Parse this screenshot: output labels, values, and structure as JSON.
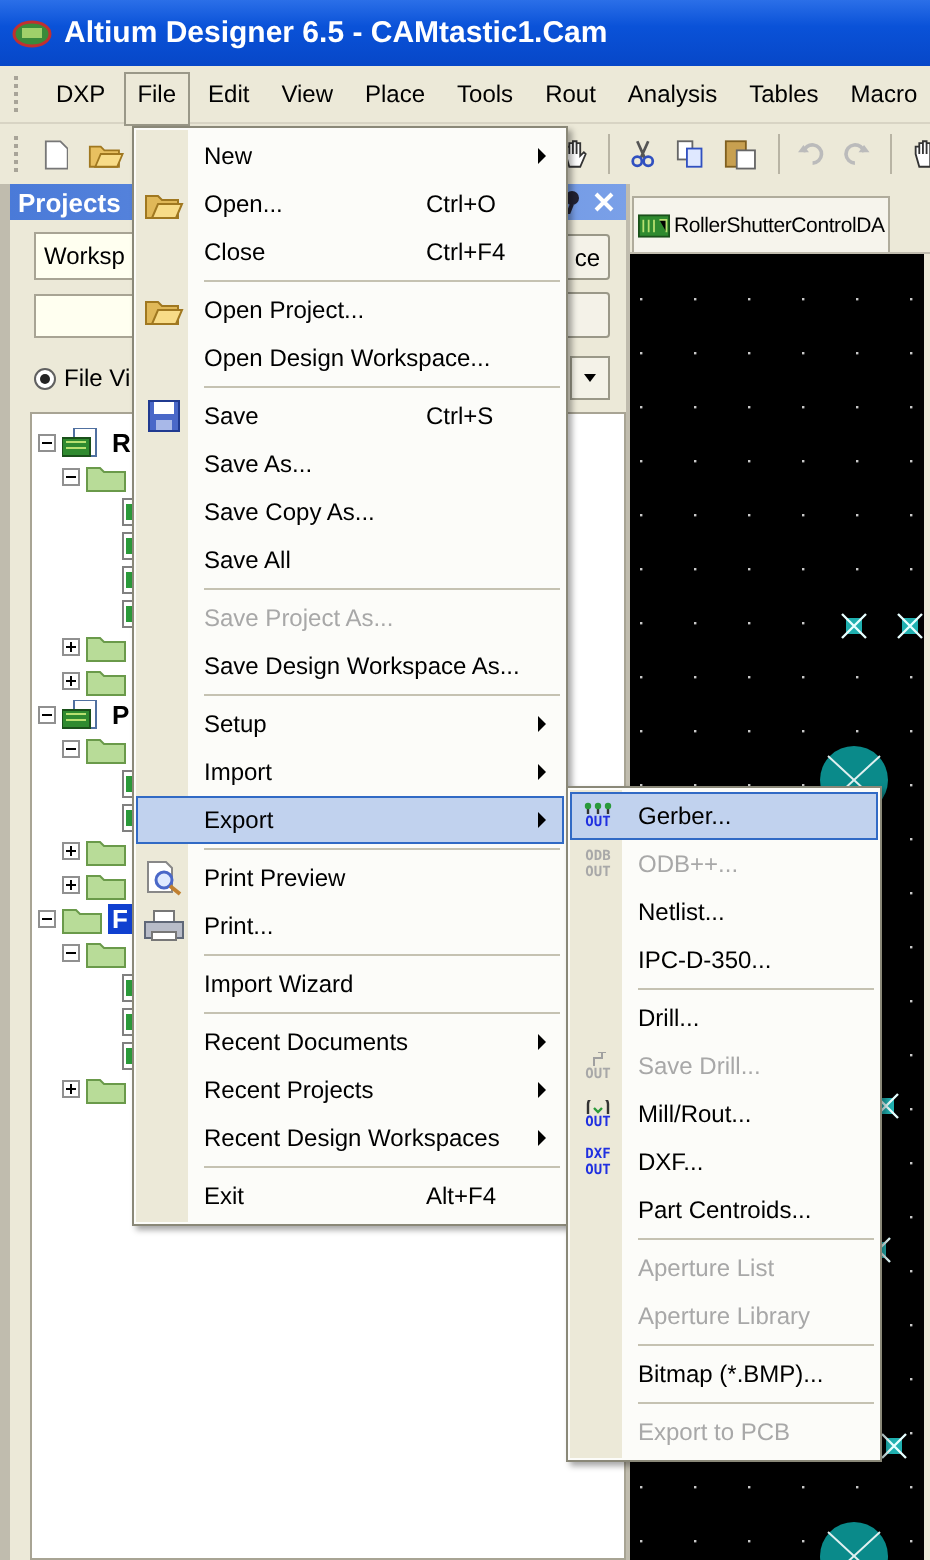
{
  "window": {
    "title": "Altium Designer 6.5 - CAMtastic1.Cam"
  },
  "menu_bar": [
    {
      "label": "DXP",
      "selected": false
    },
    {
      "label": "File",
      "selected": true
    },
    {
      "label": "Edit",
      "selected": false
    },
    {
      "label": "View",
      "selected": false
    },
    {
      "label": "Place",
      "selected": false
    },
    {
      "label": "Tools",
      "selected": false
    },
    {
      "label": "Rout",
      "selected": false
    },
    {
      "label": "Analysis",
      "selected": false
    },
    {
      "label": "Tables",
      "selected": false
    },
    {
      "label": "Macro",
      "selected": false
    }
  ],
  "panel": {
    "title": "Projects",
    "workspace_field": "Worksp",
    "workspace_button": "ce",
    "view_option": {
      "label": "File Vi",
      "selected": true
    },
    "tree": [
      {
        "label": "R",
        "kind": "project",
        "expanded": true,
        "selected": false,
        "children": [
          {
            "kind": "folder",
            "expanded": true,
            "children": [
              {
                "kind": "file"
              },
              {
                "kind": "file"
              },
              {
                "kind": "file"
              },
              {
                "kind": "file"
              }
            ]
          },
          {
            "kind": "folder",
            "expanded": false
          },
          {
            "kind": "folder",
            "expanded": false
          }
        ]
      },
      {
        "label": "P",
        "kind": "project",
        "expanded": true,
        "selected": false,
        "children": [
          {
            "kind": "folder",
            "expanded": true,
            "children": [
              {
                "kind": "file"
              },
              {
                "kind": "file"
              }
            ]
          },
          {
            "kind": "folder",
            "expanded": false
          },
          {
            "kind": "folder",
            "expanded": false
          }
        ]
      },
      {
        "label": "F",
        "kind": "folder",
        "expanded": true,
        "selected": true,
        "children": [
          {
            "kind": "folder",
            "expanded": true,
            "children": [
              {
                "kind": "file"
              },
              {
                "kind": "file"
              },
              {
                "kind": "file"
              }
            ]
          },
          {
            "kind": "folder",
            "expanded": false
          }
        ]
      }
    ]
  },
  "document_tab": {
    "label": "RollerShutterControlDA"
  },
  "file_menu": [
    {
      "kind": "item",
      "label": "New",
      "submenu": true,
      "disabled": false,
      "highlighted": false
    },
    {
      "kind": "item",
      "label": "Open...",
      "shortcut": "Ctrl+O",
      "disabled": false,
      "highlighted": false
    },
    {
      "kind": "item",
      "label": "Close",
      "shortcut": "Ctrl+F4",
      "disabled": false,
      "highlighted": false
    },
    {
      "kind": "separator"
    },
    {
      "kind": "item",
      "label": "Open Project...",
      "disabled": false,
      "highlighted": false
    },
    {
      "kind": "item",
      "label": "Open Design Workspace...",
      "disabled": false,
      "highlighted": false
    },
    {
      "kind": "separator"
    },
    {
      "kind": "item",
      "label": "Save",
      "shortcut": "Ctrl+S",
      "disabled": false,
      "highlighted": false
    },
    {
      "kind": "item",
      "label": "Save As...",
      "disabled": false,
      "highlighted": false
    },
    {
      "kind": "item",
      "label": "Save Copy As...",
      "disabled": false,
      "highlighted": false
    },
    {
      "kind": "item",
      "label": "Save All",
      "disabled": false,
      "highlighted": false
    },
    {
      "kind": "separator"
    },
    {
      "kind": "item",
      "label": "Save Project As...",
      "disabled": true,
      "highlighted": false
    },
    {
      "kind": "item",
      "label": "Save Design Workspace As...",
      "disabled": false,
      "highlighted": false
    },
    {
      "kind": "separator"
    },
    {
      "kind": "item",
      "label": "Setup",
      "submenu": true,
      "disabled": false,
      "highlighted": false
    },
    {
      "kind": "item",
      "label": "Import",
      "submenu": true,
      "disabled": false,
      "highlighted": false
    },
    {
      "kind": "item",
      "label": "Export",
      "submenu": true,
      "disabled": false,
      "highlighted": true
    },
    {
      "kind": "separator"
    },
    {
      "kind": "item",
      "label": "Print Preview",
      "disabled": false,
      "highlighted": false
    },
    {
      "kind": "item",
      "label": "Print...",
      "disabled": false,
      "highlighted": false
    },
    {
      "kind": "separator"
    },
    {
      "kind": "item",
      "label": "Import Wizard",
      "disabled": false,
      "highlighted": false
    },
    {
      "kind": "separator"
    },
    {
      "kind": "item",
      "label": "Recent Documents",
      "submenu": true,
      "disabled": false,
      "highlighted": false
    },
    {
      "kind": "item",
      "label": "Recent Projects",
      "submenu": true,
      "disabled": false,
      "highlighted": false
    },
    {
      "kind": "item",
      "label": "Recent Design Workspaces",
      "submenu": true,
      "disabled": false,
      "highlighted": false
    },
    {
      "kind": "separator"
    },
    {
      "kind": "item",
      "label": "Exit",
      "shortcut": "Alt+F4",
      "disabled": false,
      "highlighted": false
    }
  ],
  "export_submenu": [
    {
      "kind": "item",
      "label": "Gerber...",
      "icon_text": "OUT",
      "disabled": false,
      "highlighted": true
    },
    {
      "kind": "item",
      "label": "ODB++...",
      "icon_text": "ODB OUT",
      "disabled": true,
      "highlighted": false
    },
    {
      "kind": "item",
      "label": "Netlist...",
      "disabled": false,
      "highlighted": false
    },
    {
      "kind": "item",
      "label": "IPC-D-350...",
      "disabled": false,
      "highlighted": false
    },
    {
      "kind": "separator"
    },
    {
      "kind": "item",
      "label": "Drill...",
      "disabled": false,
      "highlighted": false
    },
    {
      "kind": "item",
      "label": "Save Drill...",
      "icon_text": "OUT",
      "disabled": true,
      "highlighted": false
    },
    {
      "kind": "item",
      "label": "Mill/Rout...",
      "icon_text": "OUT",
      "disabled": false,
      "highlighted": false
    },
    {
      "kind": "item",
      "label": "DXF...",
      "icon_text": "DXF OUT",
      "disabled": false,
      "highlighted": false
    },
    {
      "kind": "item",
      "label": "Part Centroids...",
      "disabled": false,
      "highlighted": false
    },
    {
      "kind": "separator"
    },
    {
      "kind": "item",
      "label": "Aperture List",
      "disabled": true,
      "highlighted": false
    },
    {
      "kind": "item",
      "label": "Aperture Library",
      "disabled": true,
      "highlighted": false
    },
    {
      "kind": "separator"
    },
    {
      "kind": "item",
      "label": "Bitmap (*.BMP)...",
      "disabled": false,
      "highlighted": false
    },
    {
      "kind": "separator"
    },
    {
      "kind": "item",
      "label": "Export to PCB",
      "disabled": true,
      "highlighted": false
    }
  ]
}
